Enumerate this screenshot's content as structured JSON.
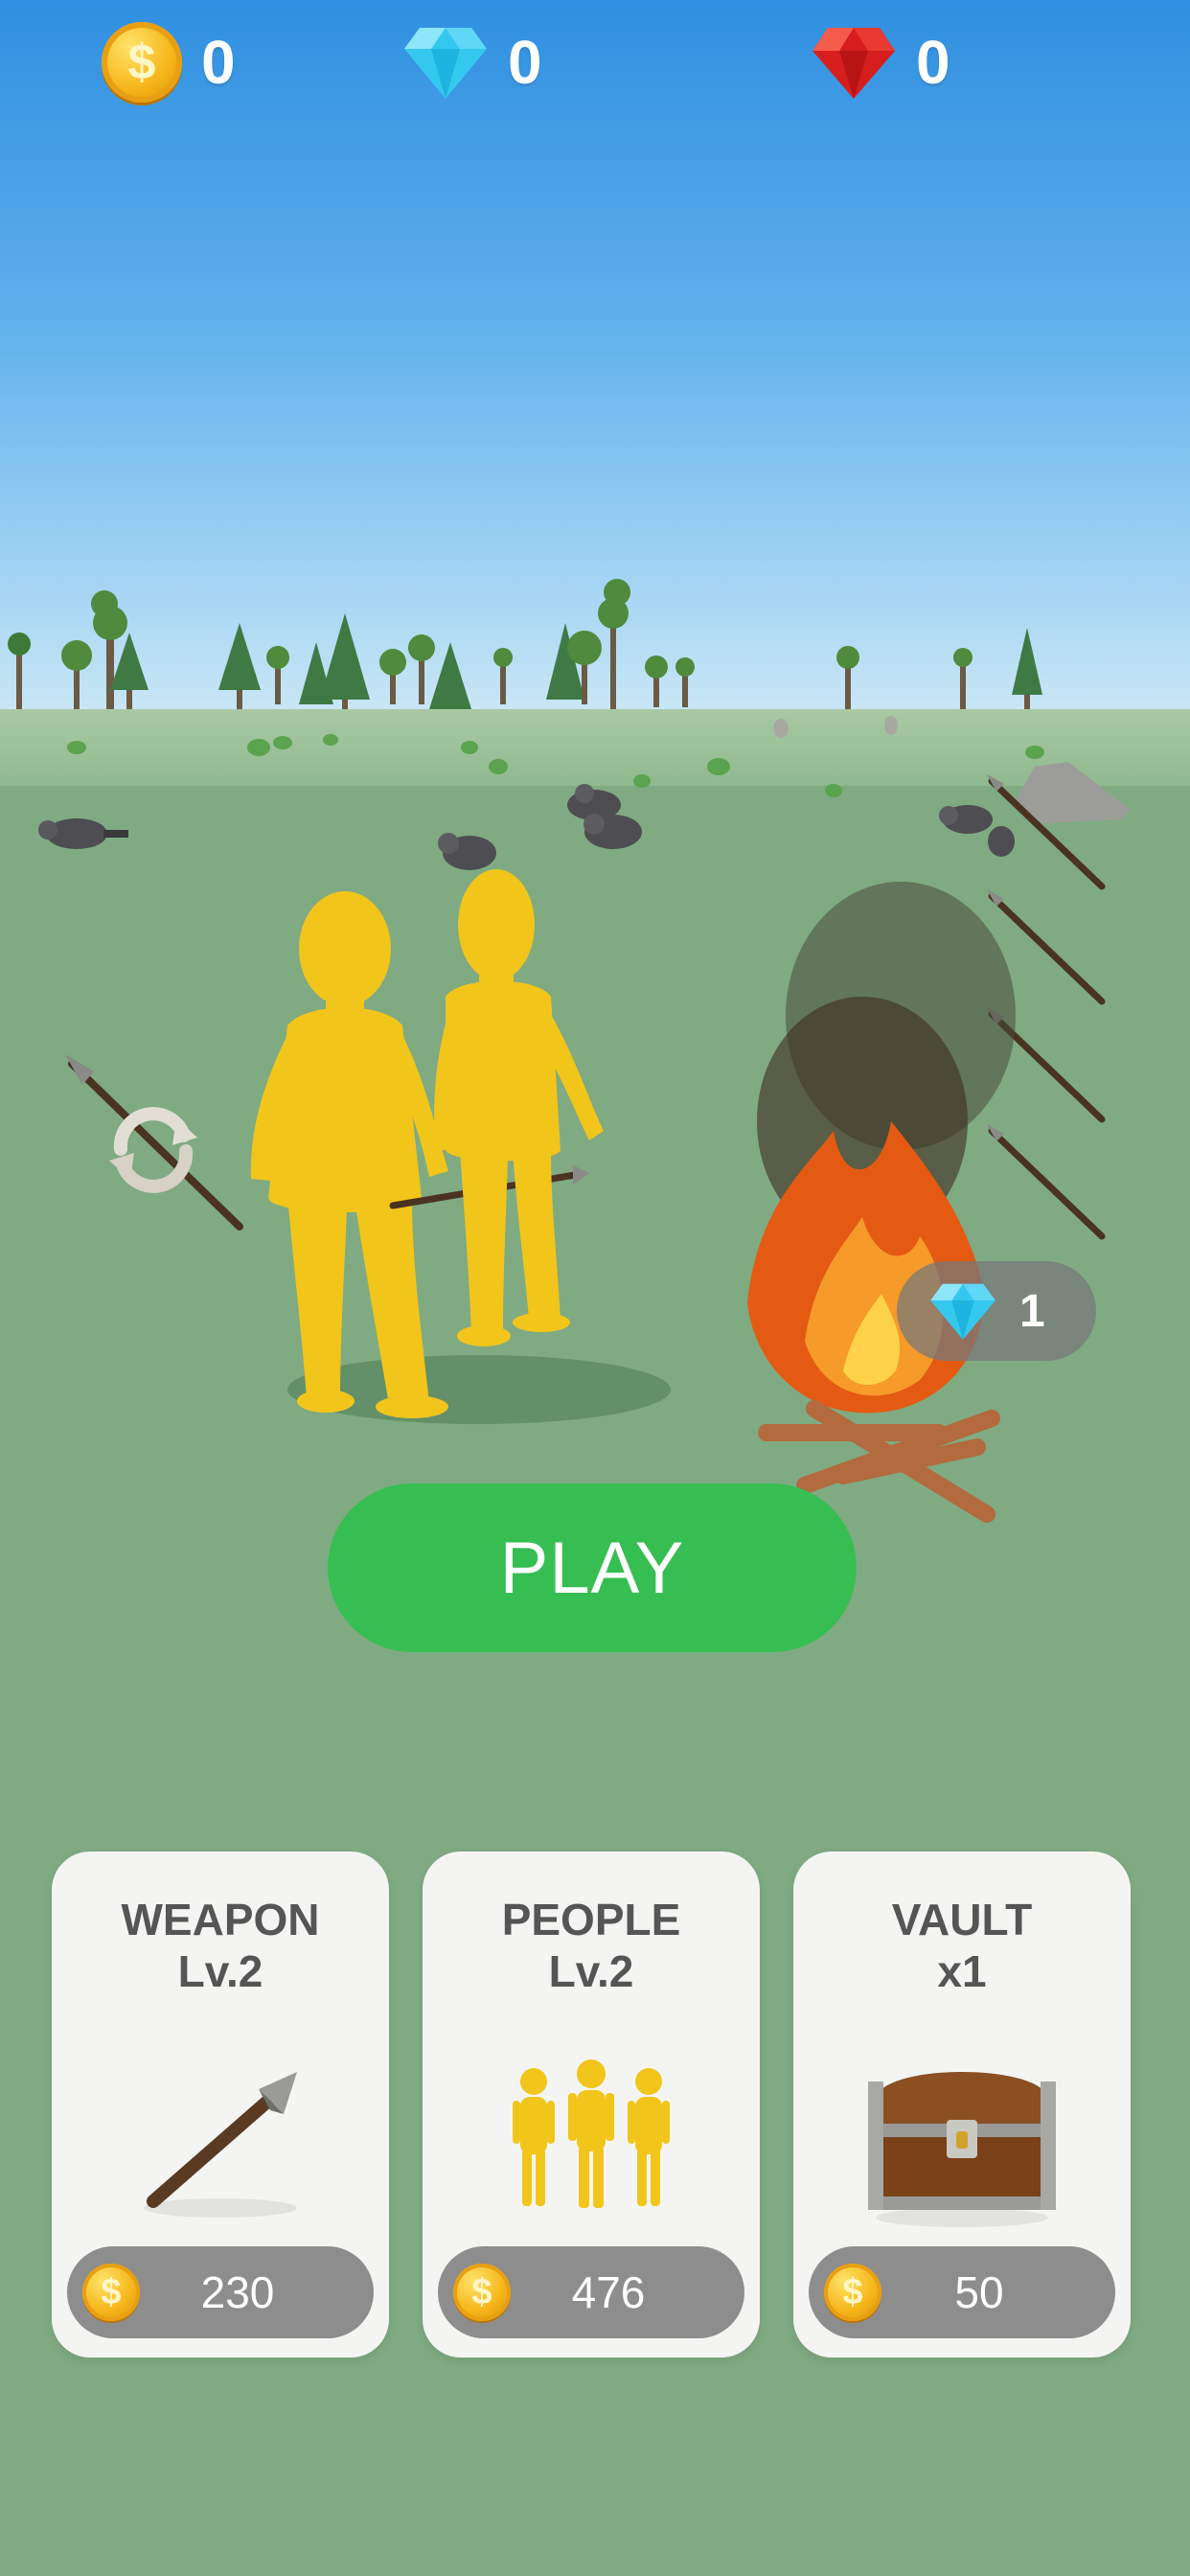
{
  "hud": {
    "coins": "0",
    "diamonds": "0",
    "rubies": "0",
    "coin_symbol": "$"
  },
  "scene": {
    "gem_counter": "1",
    "icons": [
      "rotate-icon",
      "spear-rack",
      "campfire",
      "raccoon",
      "tree",
      "rock"
    ]
  },
  "play_button": {
    "label": "PLAY",
    "color": "#36be52"
  },
  "upgrades": [
    {
      "title": "WEAPON",
      "subtitle": "Lv.2",
      "price": "230",
      "icon": "spear-icon"
    },
    {
      "title": "PEOPLE",
      "subtitle": "Lv.2",
      "price": "476",
      "icon": "people-icon"
    },
    {
      "title": "VAULT",
      "subtitle": "x1",
      "price": "50",
      "icon": "chest-icon"
    }
  ],
  "colors": {
    "sky": "#3c95e2",
    "ground": "#7faa82",
    "figure": "#f2c51b",
    "card_bg": "#f4f5f3",
    "price_pill": "#8d8d8d"
  }
}
